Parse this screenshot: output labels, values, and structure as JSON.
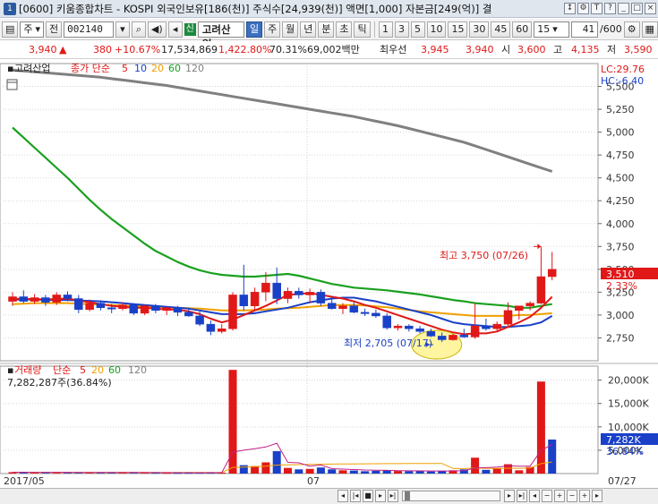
{
  "title": "[0600] 키움종합차트 - KOSPI 외국인보유[186(천)] 주식수[24,939(천)] 액면[1,000] 자본금[249(억)] 결",
  "toolbar": {
    "market": "주",
    "prev_label": "전",
    "code": "002140",
    "credit_badge": "신",
    "stock_name": "고려산업",
    "periods": [
      "일",
      "주",
      "월",
      "년",
      "분",
      "초",
      "틱"
    ],
    "selected_period": "일",
    "intervals": [
      "1",
      "3",
      "5",
      "10",
      "15",
      "30",
      "45",
      "60"
    ],
    "interval_value": "15",
    "count_value": "41",
    "count_total": "/600"
  },
  "quote": {
    "price": "3,940",
    "change": "380",
    "change_rate": "+10.67%",
    "volume": "17,534,869",
    "volume_rate": "1,422.80%",
    "turnover": "70.31%",
    "amount": "69,002백만",
    "best_bid_label": "최우선",
    "best_bid": "3,945",
    "best_ask": "3,940",
    "open_label": "시",
    "open": "3,600",
    "high_label": "고",
    "high": "4,135",
    "low_label": "저",
    "low": "3,590"
  },
  "price_panel": {
    "stock_name": "고려산업",
    "ma_label": "종가 단순",
    "ma_periods": [
      "5",
      "10",
      "20",
      "60",
      "120"
    ],
    "lc_label": "LC:29.76",
    "hc_label": "HC:-6.40",
    "high_annotation": "최고 3,750 (07/26)",
    "low_annotation": "최저 2,705 (07/17)",
    "last_price_tag": "3,510",
    "last_rate_tag": "2.33%"
  },
  "volume_panel": {
    "label": "거래량",
    "ma_label": "단순",
    "ma_periods": [
      "5",
      "20",
      "60",
      "120"
    ],
    "last_volume": "7,282,287주(36.84%)",
    "last_volume_tag": "7,282K",
    "last_rate_tag": "36.84%"
  },
  "xaxis": {
    "start_label": "2017/05",
    "mid_label": "07",
    "end_label": "07/27"
  },
  "colors": {
    "up": "#e01818",
    "down": "#1a40c8",
    "ma5": "#e01818",
    "ma10": "#1a40c8",
    "ma20": "#f0a000",
    "ma60": "#1aa020",
    "ma120": "#808080"
  },
  "chart_data": [
    {
      "type": "candlestick",
      "title": "고려산업",
      "y_ticks": [
        2750,
        3000,
        3250,
        3500,
        3750,
        4000,
        4250,
        4500,
        4750,
        5000,
        5250,
        5500
      ],
      "ylim": [
        2500,
        5750
      ],
      "candles": [
        {
          "o": 3150,
          "h": 3250,
          "l": 3100,
          "c": 3200
        },
        {
          "o": 3200,
          "h": 3270,
          "l": 3130,
          "c": 3150
        },
        {
          "o": 3150,
          "h": 3230,
          "l": 3120,
          "c": 3190
        },
        {
          "o": 3190,
          "h": 3220,
          "l": 3100,
          "c": 3140
        },
        {
          "o": 3140,
          "h": 3250,
          "l": 3110,
          "c": 3220
        },
        {
          "o": 3220,
          "h": 3260,
          "l": 3150,
          "c": 3180
        },
        {
          "o": 3180,
          "h": 3220,
          "l": 3020,
          "c": 3060
        },
        {
          "o": 3060,
          "h": 3170,
          "l": 3040,
          "c": 3130
        },
        {
          "o": 3130,
          "h": 3160,
          "l": 3050,
          "c": 3080
        },
        {
          "o": 3080,
          "h": 3120,
          "l": 3020,
          "c": 3070
        },
        {
          "o": 3070,
          "h": 3140,
          "l": 3050,
          "c": 3110
        },
        {
          "o": 3110,
          "h": 3130,
          "l": 3000,
          "c": 3020
        },
        {
          "o": 3020,
          "h": 3110,
          "l": 3000,
          "c": 3100
        },
        {
          "o": 3100,
          "h": 3120,
          "l": 3020,
          "c": 3050
        },
        {
          "o": 3050,
          "h": 3090,
          "l": 3000,
          "c": 3080
        },
        {
          "o": 3080,
          "h": 3100,
          "l": 2990,
          "c": 3030
        },
        {
          "o": 3030,
          "h": 3080,
          "l": 2980,
          "c": 2990
        },
        {
          "o": 2990,
          "h": 3040,
          "l": 2880,
          "c": 2900
        },
        {
          "o": 2900,
          "h": 2940,
          "l": 2780,
          "c": 2820
        },
        {
          "o": 2820,
          "h": 2900,
          "l": 2800,
          "c": 2850
        },
        {
          "o": 2850,
          "h": 3250,
          "l": 2830,
          "c": 3220
        },
        {
          "o": 3220,
          "h": 3550,
          "l": 3050,
          "c": 3100
        },
        {
          "o": 3100,
          "h": 3300,
          "l": 3050,
          "c": 3250
        },
        {
          "o": 3250,
          "h": 3470,
          "l": 3150,
          "c": 3350
        },
        {
          "o": 3350,
          "h": 3520,
          "l": 3120,
          "c": 3180
        },
        {
          "o": 3180,
          "h": 3300,
          "l": 3130,
          "c": 3260
        },
        {
          "o": 3260,
          "h": 3300,
          "l": 3180,
          "c": 3220
        },
        {
          "o": 3220,
          "h": 3290,
          "l": 3130,
          "c": 3250
        },
        {
          "o": 3250,
          "h": 3280,
          "l": 3100,
          "c": 3130
        },
        {
          "o": 3130,
          "h": 3200,
          "l": 3060,
          "c": 3070
        },
        {
          "o": 3070,
          "h": 3130,
          "l": 3010,
          "c": 3100
        },
        {
          "o": 3100,
          "h": 3140,
          "l": 3020,
          "c": 3030
        },
        {
          "o": 3030,
          "h": 3070,
          "l": 2990,
          "c": 3020
        },
        {
          "o": 3020,
          "h": 3060,
          "l": 2970,
          "c": 2990
        },
        {
          "o": 2990,
          "h": 3020,
          "l": 2840,
          "c": 2860
        },
        {
          "o": 2860,
          "h": 2900,
          "l": 2830,
          "c": 2880
        },
        {
          "o": 2880,
          "h": 2900,
          "l": 2820,
          "c": 2850
        },
        {
          "o": 2850,
          "h": 2880,
          "l": 2800,
          "c": 2820
        },
        {
          "o": 2820,
          "h": 2850,
          "l": 2760,
          "c": 2770
        },
        {
          "o": 2770,
          "h": 2810,
          "l": 2705,
          "c": 2730
        },
        {
          "o": 2730,
          "h": 2790,
          "l": 2720,
          "c": 2780
        },
        {
          "o": 2780,
          "h": 2850,
          "l": 2750,
          "c": 2760
        },
        {
          "o": 2760,
          "h": 3130,
          "l": 2740,
          "c": 2880
        },
        {
          "o": 2880,
          "h": 2960,
          "l": 2830,
          "c": 2850
        },
        {
          "o": 2850,
          "h": 2930,
          "l": 2820,
          "c": 2900
        },
        {
          "o": 2900,
          "h": 3140,
          "l": 2880,
          "c": 3050
        },
        {
          "o": 3050,
          "h": 3090,
          "l": 2950,
          "c": 3100
        },
        {
          "o": 3100,
          "h": 3150,
          "l": 3050,
          "c": 3130
        },
        {
          "o": 3130,
          "h": 3750,
          "l": 3120,
          "c": 3420
        },
        {
          "o": 3420,
          "h": 3690,
          "l": 3380,
          "c": 3500
        }
      ],
      "moving_averages": {
        "ma5": [
          3180,
          3175,
          3175,
          3170,
          3175,
          3180,
          3160,
          3140,
          3120,
          3100,
          3090,
          3080,
          3080,
          3070,
          3060,
          3060,
          3040,
          3010,
          2960,
          2920,
          2950,
          3000,
          3050,
          3100,
          3160,
          3220,
          3230,
          3240,
          3220,
          3200,
          3180,
          3150,
          3110,
          3080,
          3040,
          3000,
          2960,
          2920,
          2880,
          2840,
          2810,
          2790,
          2800,
          2800,
          2820,
          2870,
          2920,
          2980,
          3080,
          3200
        ],
        "ma10": [
          3170,
          3170,
          3170,
          3165,
          3165,
          3165,
          3160,
          3155,
          3150,
          3140,
          3130,
          3120,
          3110,
          3100,
          3090,
          3080,
          3070,
          3050,
          3030,
          3010,
          3010,
          3010,
          3020,
          3040,
          3060,
          3080,
          3110,
          3140,
          3160,
          3180,
          3190,
          3190,
          3170,
          3150,
          3120,
          3090,
          3060,
          3030,
          3000,
          2960,
          2920,
          2900,
          2890,
          2880,
          2870,
          2870,
          2880,
          2890,
          2920,
          2990
        ],
        "ma20": [
          3120,
          3125,
          3130,
          3130,
          3130,
          3130,
          3125,
          3120,
          3115,
          3110,
          3105,
          3100,
          3095,
          3090,
          3085,
          3080,
          3075,
          3070,
          3060,
          3050,
          3050,
          3050,
          3055,
          3060,
          3070,
          3075,
          3080,
          3090,
          3100,
          3110,
          3110,
          3110,
          3105,
          3095,
          3085,
          3070,
          3055,
          3040,
          3030,
          3020,
          3010,
          3000,
          2990,
          2990,
          2990,
          2990,
          3000,
          3000,
          3010,
          3020
        ],
        "ma60": [
          5050,
          4940,
          4830,
          4720,
          4610,
          4500,
          4380,
          4260,
          4150,
          4050,
          3960,
          3870,
          3780,
          3700,
          3640,
          3580,
          3530,
          3490,
          3460,
          3440,
          3430,
          3420,
          3420,
          3430,
          3440,
          3450,
          3430,
          3400,
          3370,
          3340,
          3320,
          3300,
          3290,
          3280,
          3270,
          3255,
          3240,
          3225,
          3205,
          3185,
          3165,
          3150,
          3130,
          3120,
          3110,
          3100,
          3080,
          3080,
          3100,
          3120
        ],
        "ma120": [
          5680,
          5670,
          5660,
          5650,
          5640,
          5630,
          5620,
          5610,
          5600,
          5585,
          5570,
          5555,
          5540,
          5525,
          5510,
          5490,
          5470,
          5450,
          5430,
          5410,
          5390,
          5370,
          5350,
          5330,
          5310,
          5290,
          5270,
          5250,
          5230,
          5210,
          5190,
          5170,
          5145,
          5120,
          5095,
          5070,
          5040,
          5010,
          4980,
          4950,
          4920,
          4890,
          4850,
          4810,
          4770,
          4730,
          4690,
          4650,
          4610,
          4570
        ]
      }
    },
    {
      "type": "bar",
      "title": "거래량",
      "y_ticks": [
        5000,
        10000,
        15000,
        20000
      ],
      "y_tick_labels": [
        "5,000K",
        "10,000K",
        "15,000K",
        "20,000K"
      ],
      "ylim": [
        0,
        23000
      ],
      "values": [
        300,
        280,
        260,
        240,
        250,
        230,
        260,
        240,
        220,
        210,
        230,
        200,
        190,
        180,
        170,
        160,
        170,
        180,
        220,
        200,
        22200,
        1800,
        1600,
        2400,
        4800,
        1200,
        900,
        1000,
        1300,
        900,
        700,
        650,
        500,
        600,
        700,
        550,
        500,
        600,
        450,
        500,
        700,
        900,
        3400,
        800,
        1100,
        2000,
        700,
        1400,
        19700,
        7282
      ],
      "up": [
        true,
        false,
        true,
        false,
        true,
        false,
        false,
        true,
        false,
        false,
        true,
        false,
        true,
        false,
        true,
        false,
        false,
        false,
        false,
        true,
        true,
        false,
        true,
        true,
        false,
        true,
        false,
        true,
        false,
        false,
        true,
        false,
        false,
        false,
        false,
        true,
        false,
        false,
        false,
        false,
        true,
        false,
        true,
        false,
        true,
        true,
        true,
        true,
        true,
        false
      ],
      "ma5": [
        280,
        280,
        275,
        270,
        265,
        260,
        255,
        250,
        245,
        240,
        235,
        230,
        220,
        210,
        200,
        190,
        185,
        180,
        185,
        190,
        4600,
        5000,
        5300,
        5700,
        6500,
        2400,
        2300,
        1600,
        1840,
        1060,
        960,
        870,
        760,
        730,
        690,
        630,
        600,
        570,
        560,
        550,
        560,
        630,
        1190,
        1270,
        1380,
        1640,
        1600,
        1600,
        4980,
        6200
      ],
      "ma20": [
        260,
        260,
        258,
        256,
        254,
        252,
        250,
        248,
        246,
        244,
        242,
        240,
        238,
        236,
        234,
        232,
        230,
        228,
        226,
        224,
        1330,
        1400,
        1480,
        1590,
        1820,
        1870,
        1910,
        1950,
        2000,
        2030,
        2050,
        2070,
        2080,
        2100,
        2120,
        2130,
        2140,
        2150,
        2160,
        2170,
        1100,
        1080,
        1180,
        1110,
        1100,
        1150,
        1140,
        1180,
        2130,
        2470
      ]
    }
  ]
}
